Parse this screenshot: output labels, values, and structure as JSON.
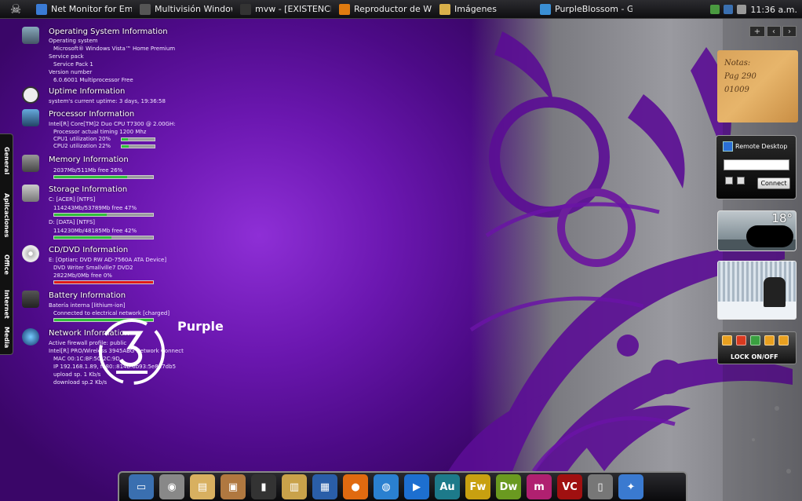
{
  "taskbar": {
    "tasks": [
      {
        "label": "Net Monitor for Em...",
        "icon": "network-monitor-icon",
        "color": "#3a7bd5"
      },
      {
        "label": "Multivisión Window...",
        "icon": "multivision-icon",
        "color": "#555555"
      },
      {
        "label": "mvw - [EXISTENCIA ...",
        "icon": "mvw-icon",
        "color": "#333333"
      },
      {
        "label": "Reproductor de Win...",
        "icon": "media-player-icon",
        "color": "#e07b10"
      },
      {
        "label": "Imágenes",
        "icon": "folder-icon",
        "color": "#d9b04a"
      },
      {
        "label": "PurpleBlossom - Gal...",
        "icon": "gallery-icon",
        "color": "#3a8fd5"
      }
    ],
    "clock": "11:36 a.m."
  },
  "sidetabs": [
    "General",
    "Aplicaciones",
    "Office",
    "Internet",
    "Media"
  ],
  "sysinfo": {
    "os": {
      "title": "Operating System Information",
      "lines": [
        "Operating system",
        "Microsoft® Windows Vista™ Home Premium",
        "Service pack",
        "Service Pack 1",
        "Version number",
        "6.0.6001  Multiprocessor Free"
      ]
    },
    "uptime": {
      "title": "Uptime Information",
      "lines": [
        "system's current uptime: 3 days, 19:36:58"
      ]
    },
    "processor": {
      "title": "Processor Information",
      "lines": [
        "Intel[R] Core[TM]2 Duo CPU      T7300  @ 2.00GH:",
        "Processor actual timing 1200 Mhz",
        "CPU1 utilization    20%",
        "CPU2 utilization    22%"
      ],
      "cpu1": 0.2,
      "cpu2": 0.22
    },
    "memory": {
      "title": "Memory Information",
      "lines": [
        "2037Mb/511Mb  free 26%"
      ],
      "used": 0.74
    },
    "storage": {
      "title": "Storage Information",
      "lines": [
        "C: [ACER]  [NTFS]",
        "114243Mb/53789Mb  free 47%",
        "D: [DATA]  [NTFS]",
        "114230Mb/48185Mb  free 42%"
      ],
      "c_used": 0.53,
      "d_used": 0.58
    },
    "cddvd": {
      "title": "CD/DVD Information",
      "lines": [
        "E: [Optiarc DVD RW AD-7560A ATA Device]",
        "DVD Writer          Smallville7 DVD2",
        "2822Mb/0Mb  free 0%"
      ],
      "used": 1.0
    },
    "battery": {
      "title": "Battery Information",
      "lines": [
        "Batería interna [lithium-ion]",
        "Connected to electrical network [charged]"
      ],
      "level": 1.0
    },
    "network": {
      "title": "Network Information",
      "lines": [
        "Active firewall profile: public",
        "Intel[R] PRO/Wireless 3945ABG Network Connect",
        "MAC 00:1C:BF:5C:2C:9D",
        "IP  192.168.1.89, fe80::814b:6b93:5e8f:7db5",
        "upload sp.    1 Kb/s",
        "download sp.2 Kb/s"
      ]
    }
  },
  "logo_text": "Purple",
  "gadgets": {
    "notes": [
      "Notas:",
      "Pag 290",
      "01009"
    ],
    "remote_desktop": {
      "title": "Remote Desktop",
      "input_value": "",
      "connect_label": "Connect"
    },
    "weather": {
      "temp": "18°"
    },
    "lock": {
      "label": "LOCK ON/OFF"
    },
    "controls": [
      "+",
      "‹",
      "›"
    ]
  },
  "dock": {
    "items": [
      {
        "icon": "computer-icon",
        "color": "#3a6fb0",
        "glyph": "▭"
      },
      {
        "icon": "camera-icon",
        "color": "#888888",
        "glyph": "◉"
      },
      {
        "icon": "documents-icon",
        "color": "#d8b060",
        "glyph": "▤"
      },
      {
        "icon": "photos-icon",
        "color": "#b07840",
        "glyph": "▣"
      },
      {
        "icon": "ipod-icon",
        "color": "#333333",
        "glyph": "▮"
      },
      {
        "icon": "folder-icon",
        "color": "#c9a24a",
        "glyph": "▥"
      },
      {
        "icon": "calendar-icon",
        "color": "#2a5ea8",
        "glyph": "▦"
      },
      {
        "icon": "firefox-icon",
        "color": "#e06a10",
        "glyph": "●"
      },
      {
        "icon": "network-globe-icon",
        "color": "#2a80d0",
        "glyph": "◍"
      },
      {
        "icon": "media-player-icon",
        "color": "#1d6fd0",
        "glyph": "▶"
      },
      {
        "icon": "audition-icon",
        "color": "#1d7a8a",
        "glyph": "Au"
      },
      {
        "icon": "fireworks-icon",
        "color": "#c8a010",
        "glyph": "Fw"
      },
      {
        "icon": "dreamweaver-icon",
        "color": "#6a9a20",
        "glyph": "Dw"
      },
      {
        "icon": "msn-icon",
        "color": "#b02070",
        "glyph": "m"
      },
      {
        "icon": "vlc-icon",
        "color": "#a01010",
        "glyph": "VC"
      },
      {
        "icon": "recycle-bin-icon",
        "color": "#777777",
        "glyph": "▯"
      },
      {
        "icon": "settings-icon",
        "color": "#3a7ad0",
        "glyph": "✦"
      }
    ]
  }
}
